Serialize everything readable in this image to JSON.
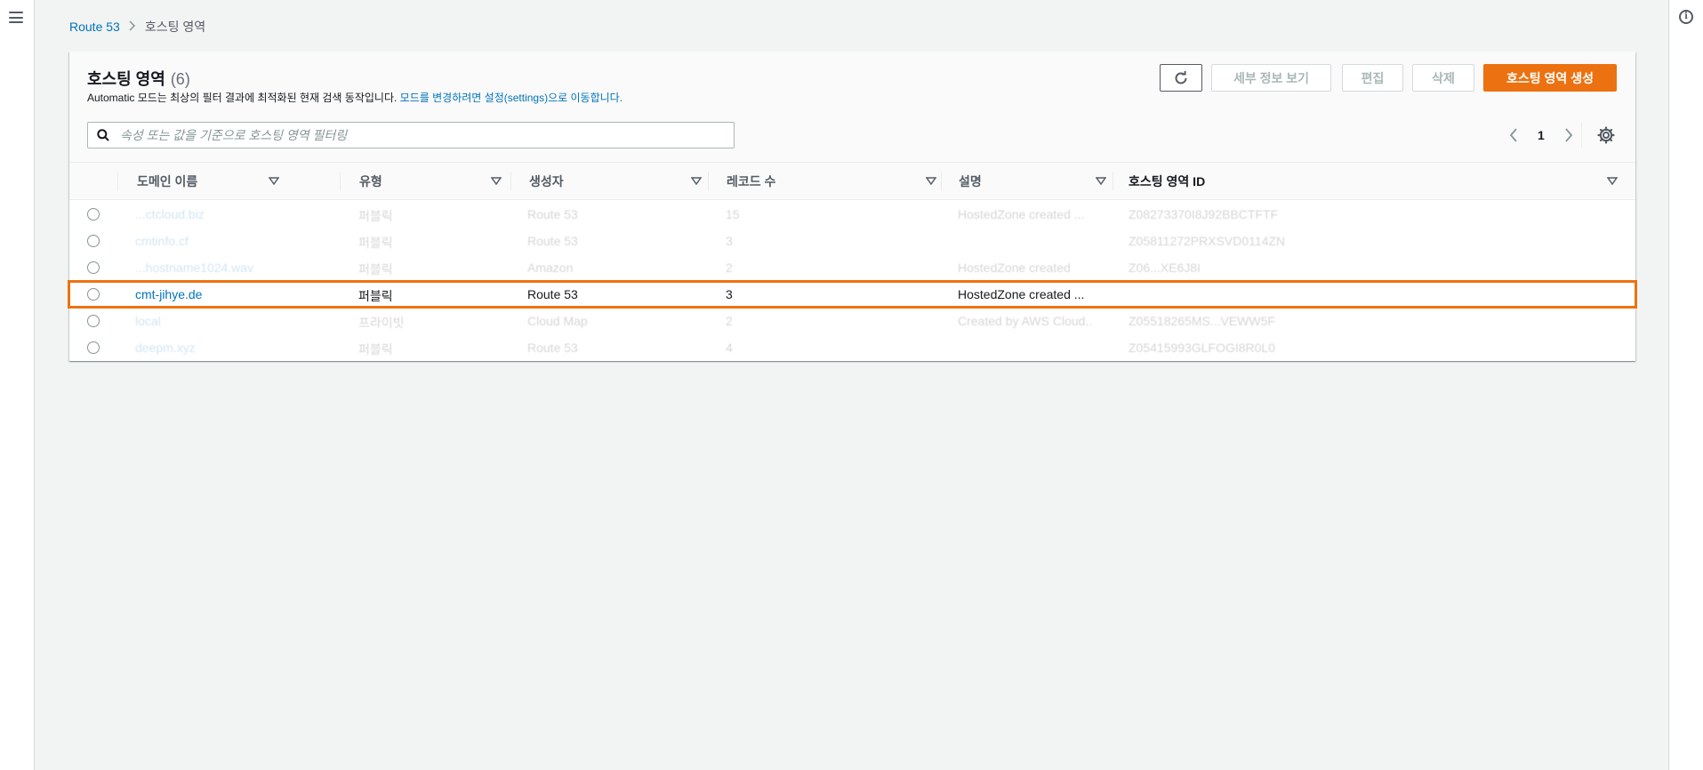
{
  "breadcrumb": {
    "root": "Route 53",
    "separator": ">",
    "current": "호스팅 영역"
  },
  "header": {
    "title": "호스팅 영역",
    "count": "(6)",
    "subtitle_prefix": "Automatic 모드는 최상의 필터 결과에 최적화된 현재 검색 동작입니다.",
    "subtitle_link": "모드를 변경하려면 설정(settings)으로 이동합니다."
  },
  "toolbar": {
    "refresh_icon": "refresh-icon",
    "details_label": "세부 정보 보기",
    "edit_label": "편집",
    "delete_label": "삭제",
    "create_label": "호스팅 영역 생성"
  },
  "search": {
    "placeholder": "속성 또는 값을 기준으로 호스팅 영역 필터링",
    "value": ""
  },
  "pagination": {
    "current_page": "1"
  },
  "columns": [
    "도메인 이름",
    "유형",
    "생성자",
    "레코드 수",
    "설명",
    "호스팅 영역 ID"
  ],
  "rows": [
    {
      "domain": "...ctcloud.biz",
      "type": "퍼블릭",
      "created_by": "Route 53",
      "records": "15",
      "description": "HostedZone created ...",
      "zone_id": "Z08273370I8J92BBCTFTF"
    },
    {
      "domain": "cmtinfo.cf",
      "type": "퍼블릭",
      "created_by": "Route 53",
      "records": "3",
      "description": "",
      "zone_id": "Z05811272PRXSVD0114ZN"
    },
    {
      "domain": "...hostname1024.wav",
      "type": "퍼블릭",
      "created_by": "Amazon",
      "records": "2",
      "description": "HostedZone created",
      "zone_id": "Z06...XE6J8I"
    },
    {
      "domain": "cmt-jihye.de",
      "type": "퍼블릭",
      "created_by": "Route 53",
      "records": "3",
      "description": "HostedZone created ...",
      "zone_id": ""
    },
    {
      "domain": "local",
      "type": "프라이빗",
      "created_by": "Cloud Map",
      "records": "2",
      "description": "Created by AWS Cloud...",
      "zone_id": "Z05518265MS...VEWW5F"
    },
    {
      "domain": "deepm.xyz",
      "type": "퍼블릭",
      "created_by": "Route 53",
      "records": "4",
      "description": "",
      "zone_id": "Z05415993GLFOGI8R0L0"
    }
  ],
  "highlighted_row_index": 3,
  "colors": {
    "accent": "#ec7211",
    "link": "#0073bb",
    "text": "#16191f"
  }
}
